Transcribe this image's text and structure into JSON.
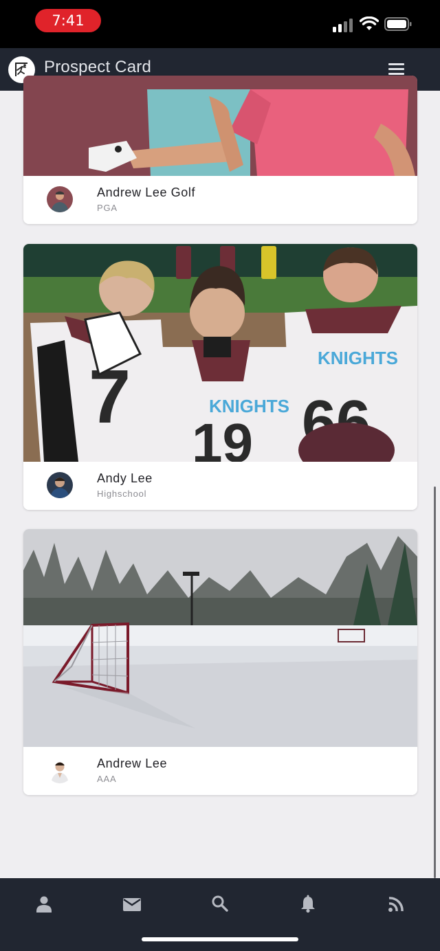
{
  "status_bar": {
    "time": "7:41"
  },
  "app_bar": {
    "title": "Prospect Card",
    "logo_icon": "runner-flag-icon",
    "menu_icon": "hamburger-menu-icon"
  },
  "cards": [
    {
      "name": "Andrew Lee Golf",
      "level": "PGA",
      "photo": "golfers-photo"
    },
    {
      "name": "Andy Lee",
      "level": "Highschool",
      "photo": "football-players-photo"
    },
    {
      "name": "Andrew Lee",
      "level": "AAA",
      "photo": "ice-rink-photo"
    }
  ],
  "tabs": [
    {
      "name": "profile",
      "icon": "person-icon"
    },
    {
      "name": "messages",
      "icon": "mail-icon"
    },
    {
      "name": "search",
      "icon": "search-icon"
    },
    {
      "name": "notifications",
      "icon": "bell-icon"
    },
    {
      "name": "feed",
      "icon": "rss-icon"
    }
  ],
  "colors": {
    "app_bar": "#212631",
    "background": "#efeef1",
    "time_pill": "#e0232a"
  }
}
